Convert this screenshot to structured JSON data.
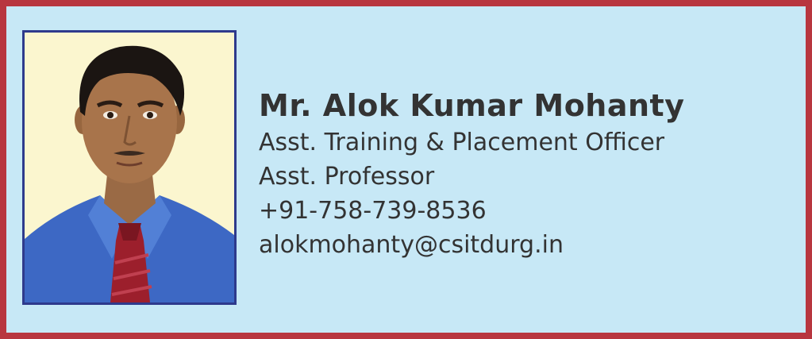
{
  "profile": {
    "name": "Mr. Alok Kumar Mohanty",
    "designation_1": "Asst. Training & Placement Officer",
    "designation_2": "Asst. Professor",
    "phone": "+91-758-739-8536",
    "email": "alokmohanty@csitdurg.in"
  },
  "colors": {
    "border": "#b8363f",
    "background": "#c7e8f6",
    "photo_border": "#2e3a8c",
    "photo_background": "#fbf6cf",
    "text": "#333333"
  },
  "photo": {
    "icon": "person-portrait-icon"
  }
}
